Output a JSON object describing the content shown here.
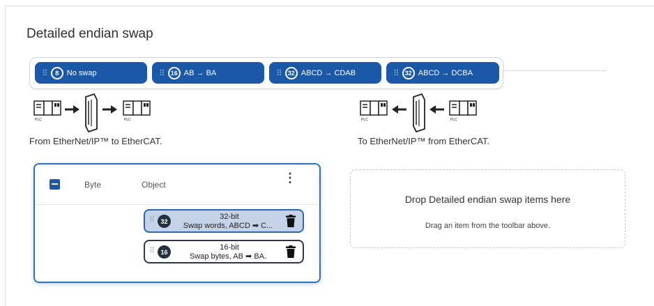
{
  "title": "Detailed endian swap",
  "toolbar": {
    "chips": [
      {
        "num": "8",
        "label": "No swap"
      },
      {
        "num": "16",
        "label": "AB → BA"
      },
      {
        "num": "32",
        "label": "ABCD → CDAB"
      },
      {
        "num": "32",
        "label": "ABCD → DCBA"
      }
    ]
  },
  "flows": {
    "left_caption": "From EtherNet/IP™ to EtherCAT.",
    "right_caption": "To EtherNet/IP™ from EtherCAT.",
    "plc_label": "PLC"
  },
  "card": {
    "col_byte": "Byte",
    "col_object": "Object",
    "menu": "⋮",
    "items": [
      {
        "num": "32",
        "line1": "32-bit",
        "line2": "Swap words, ABCD ➡ C..."
      },
      {
        "num": "16",
        "line1": "16-bit",
        "line2": "Swap bytes, AB ➡ BA."
      }
    ]
  },
  "dropzone": {
    "title": "Drop Detailed endian swap items here",
    "subtitle": "Drag an item from the toolbar above."
  },
  "colors": {
    "accent": "#1b58a8",
    "card_border": "#2a6fc4",
    "dark": "#22303f"
  }
}
